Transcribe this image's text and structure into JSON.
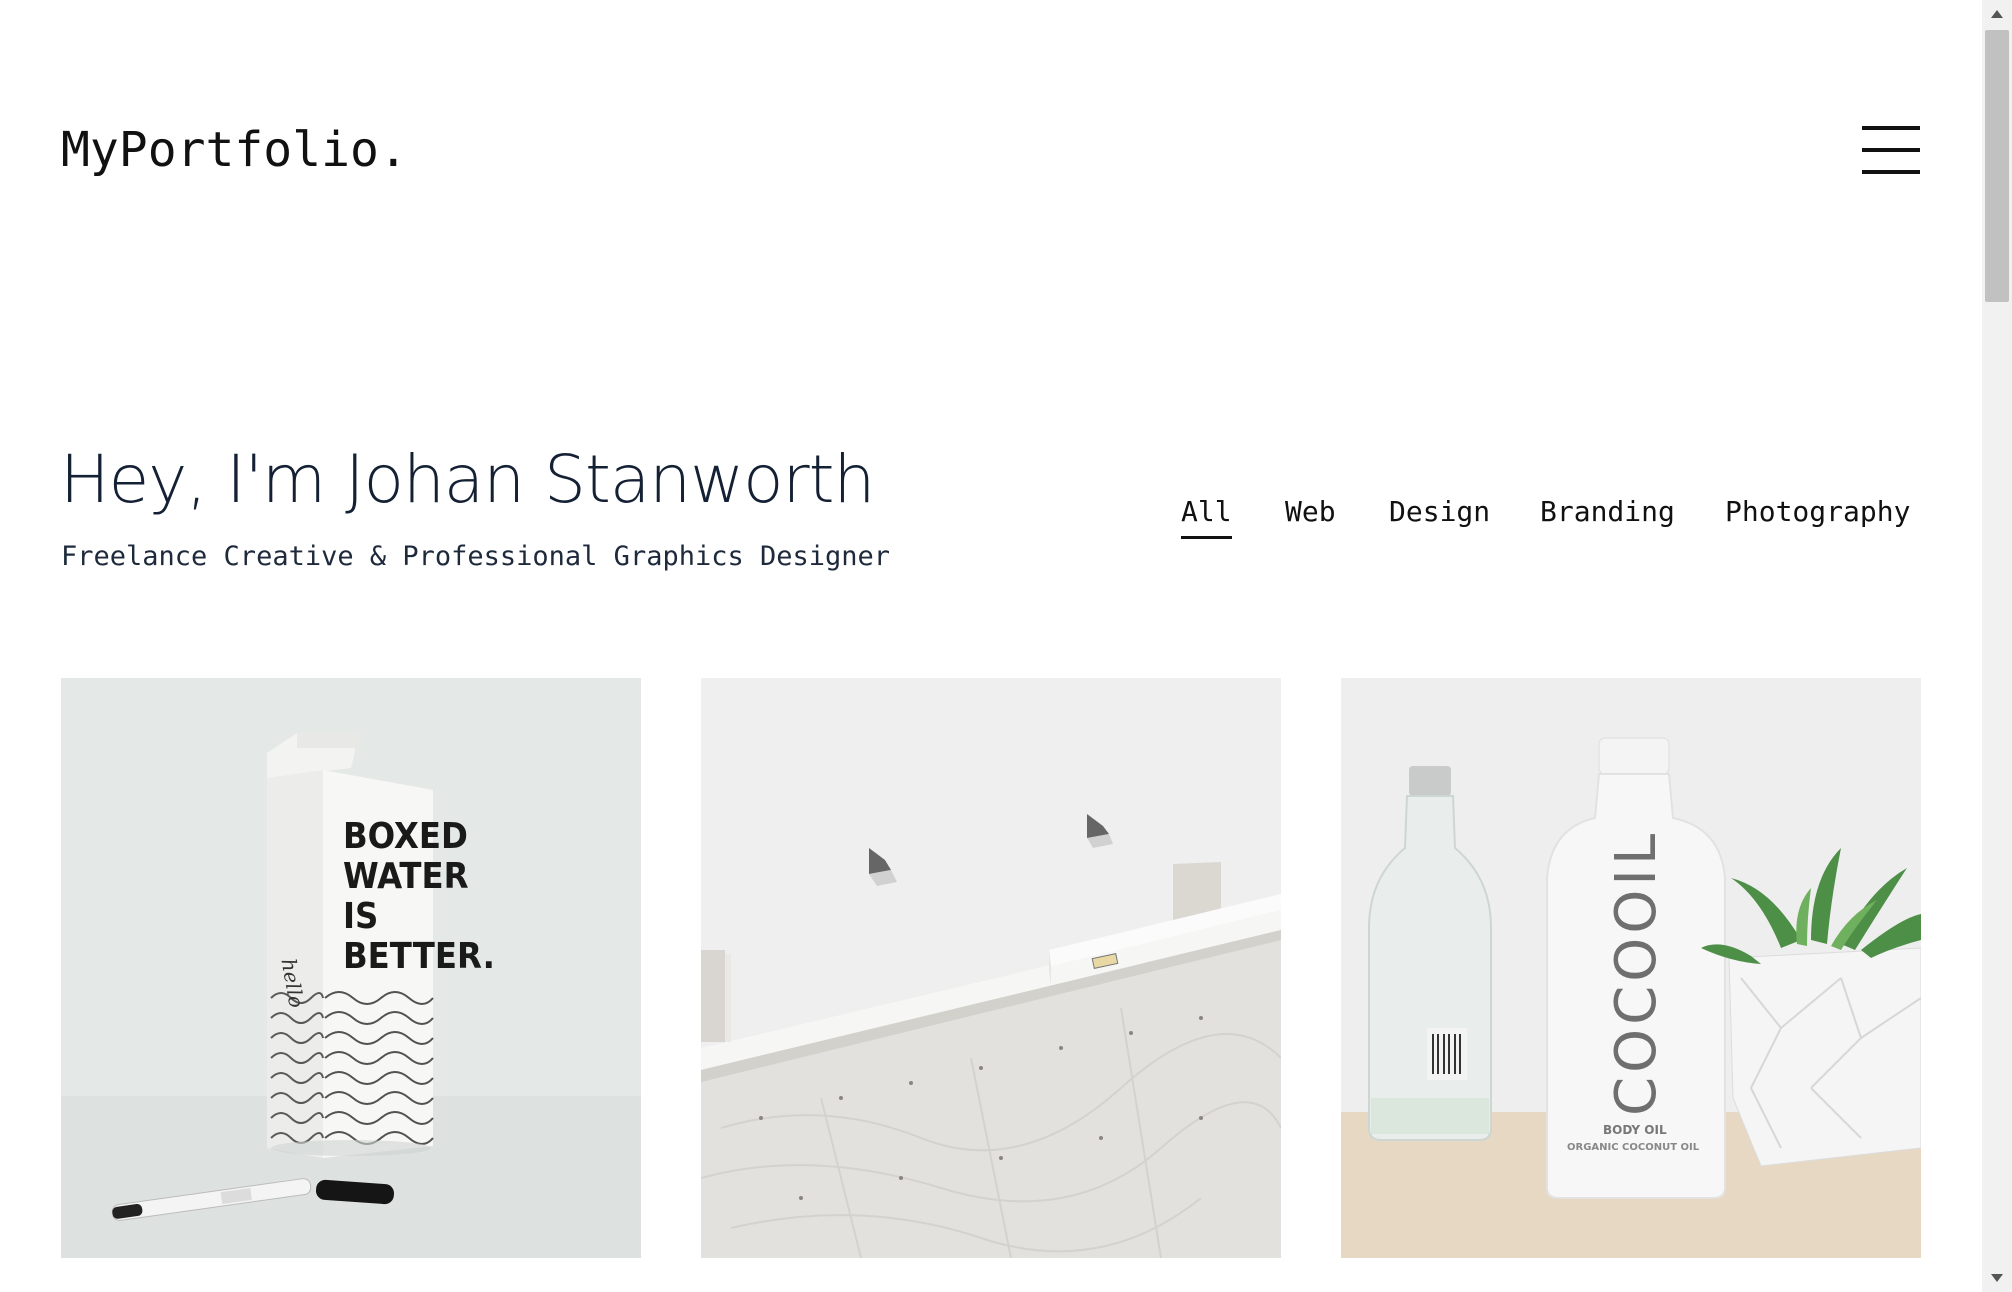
{
  "header": {
    "logo": "MyPortfolio.",
    "menu_icon": "hamburger-menu-icon"
  },
  "hero": {
    "title": "Hey, I'm Johan Stanworth",
    "subtitle": "Freelance Creative & Professional Graphics Designer"
  },
  "filters": {
    "active": "All",
    "items": [
      {
        "label": "All"
      },
      {
        "label": "Web"
      },
      {
        "label": "Design"
      },
      {
        "label": "Branding"
      },
      {
        "label": "Photography"
      }
    ]
  },
  "portfolio": {
    "items": [
      {
        "image": "boxed-water-carton-photo",
        "carton_text": [
          "BOXED",
          "WATER",
          "IS",
          "BETTER."
        ],
        "script_text": "hello"
      },
      {
        "image": "architecture-wall-photo"
      },
      {
        "image": "cocooil-bottle-photo",
        "bottle_text": "COCOOIL",
        "bottle_sub": [
          "BODY OIL",
          "ORGANIC COCONUT OIL"
        ]
      }
    ]
  },
  "colors": {
    "text": "#142033",
    "background": "#ffffff",
    "accent": "#111111"
  }
}
